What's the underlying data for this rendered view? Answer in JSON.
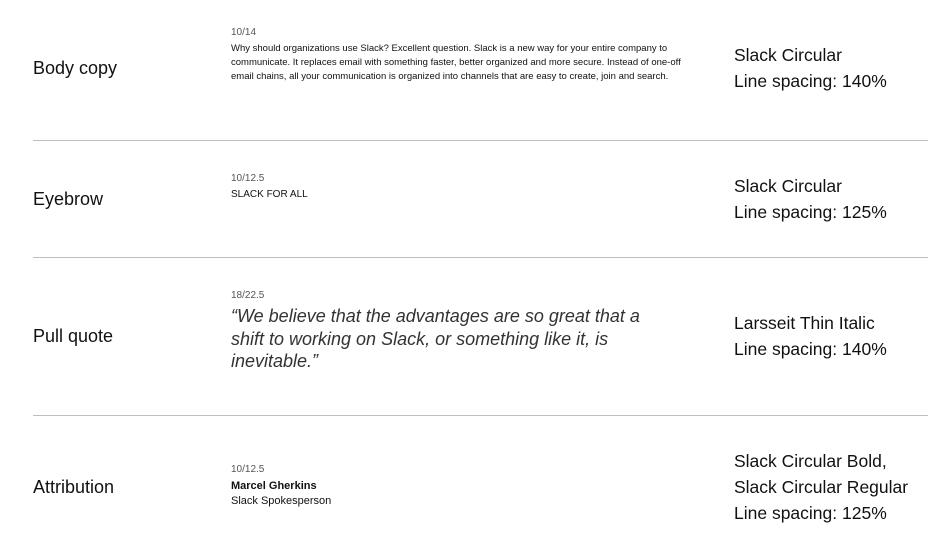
{
  "rows": [
    {
      "name": "Body copy",
      "size": "10/14",
      "sample": "Why should organizations use Slack? Excellent question. Slack is a new way for your entire company to communicate. It replaces email with something faster, better organized and more secure. Instead of one-off email chains, all your communication is organized into channels that are easy to create, join and search.",
      "font": "Slack Circular",
      "spacing": "Line spacing: 140%"
    },
    {
      "name": "Eyebrow",
      "size": "10/12.5",
      "sample": "SLACK FOR ALL",
      "font": "Slack Circular",
      "spacing": "Line spacing: 125%"
    },
    {
      "name": "Pull quote",
      "size": "18/22.5",
      "sample": "“We believe that the advantages are so great that a shift to working on Slack, or something like it, is inevitable.”",
      "font": "Larsseit Thin Italic",
      "spacing": "Line spacing: 140%"
    },
    {
      "name": "Attribution",
      "size": "10/12.5",
      "sample_name": "Marcel Gherkins",
      "sample_title": "Slack Spokesperson",
      "font_line1": "Slack Circular Bold,",
      "font_line2": "Slack Circular Regular",
      "spacing": "Line spacing: 125%"
    }
  ],
  "colors": {
    "text": "#111111",
    "muted": "#555555",
    "divider": "#bdbdbd",
    "background": "#ffffff"
  }
}
